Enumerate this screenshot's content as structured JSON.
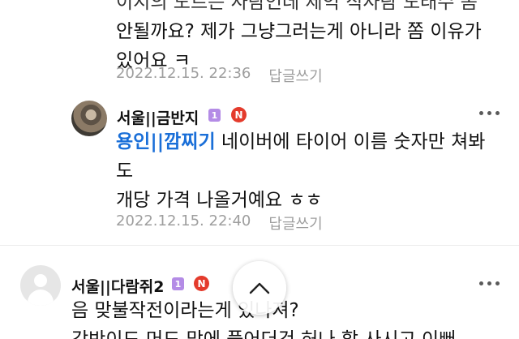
{
  "comments": [
    {
      "body_lines": [
        "이지의 도르는 사람인데 제익 직사람 도래수 몸",
        "안될까요? 제가 그냥그러는게 아니라 쫌 이유가",
        "있어요 ㅋ"
      ],
      "date": "2022.12.15. 22:36",
      "reply_label": "답글쓰기"
    },
    {
      "author": "서울||금반지",
      "level_badge": "1",
      "n_badge": "N",
      "mention": "용인||깜찌기",
      "body_first": " 네이버에 타이어 이름 숫자만 쳐봐",
      "body_lines": [
        "도",
        "개당 가격 나올거예요 ㅎㅎ"
      ],
      "date": "2022.12.15. 22:40",
      "reply_label": "답글쓰기"
    },
    {
      "author": "서울||다람쥐2",
      "level_badge": "1",
      "n_badge": "N",
      "body_lines": [
        "음 맞불작전이라는게 있나져?",
        "강반이드 머드 맏에 풀어더건 허나 할 사시고 이뻐"
      ]
    }
  ],
  "icons": {
    "more": "more-vertical-icon",
    "scroll_top": "chevron-up-icon"
  },
  "colors": {
    "mention": "#1a6fd8",
    "level_badge": "#b48ce6",
    "n_badge": "#e43b2c",
    "meta": "#9e9e9e"
  }
}
